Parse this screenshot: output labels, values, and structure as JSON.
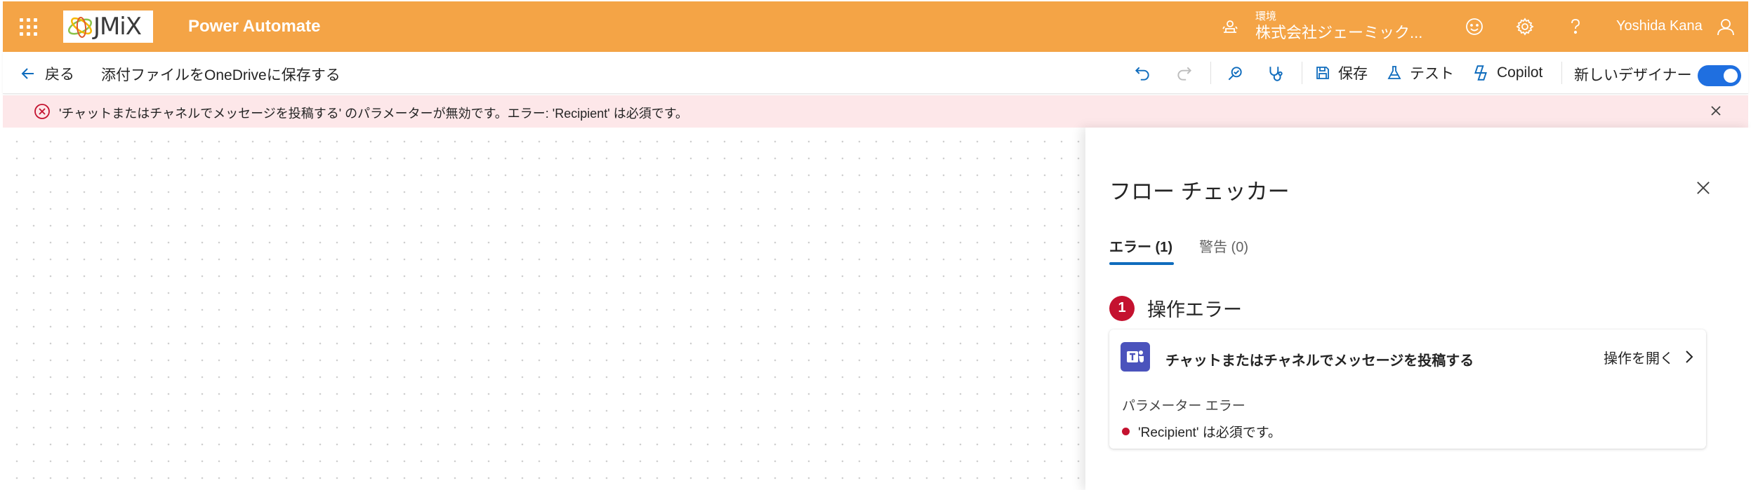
{
  "appbar": {
    "app_name": "Power Automate",
    "logo_text": "JMiX",
    "environment_label": "環境",
    "environment_name": "株式会社ジェーミック...",
    "user_name": "Yoshida Kana",
    "icons": [
      "waffle-icon",
      "environment-icon",
      "feedback-icon",
      "settings-icon",
      "help-icon",
      "user-icon"
    ]
  },
  "cmdbar": {
    "back_label": "戻る",
    "flow_title": "添付ファイルをOneDriveに保存する",
    "save_label": "保存",
    "test_label": "テスト",
    "copilot_label": "Copilot",
    "new_designer_label": "新しいデザイナー",
    "new_designer_on": true
  },
  "banner": {
    "message": "'チャットまたはチャネルでメッセージを投稿する' のパラメーターが無効です。エラー: 'Recipient' は必須です。"
  },
  "panel": {
    "title": "フロー チェッカー",
    "tabs": [
      {
        "label": "エラー (1)",
        "active": true
      },
      {
        "label": "警告 (0)",
        "active": false
      }
    ],
    "section_count": "1",
    "section_title": "操作エラー",
    "card": {
      "action_name": "チャットまたはチャネルでメッセージを投稿する",
      "open_label": "操作を開く",
      "error_type": "パラメーター エラー",
      "error_detail": "'Recipient' は必須です。"
    }
  },
  "colors": {
    "appbar": "#f4a446",
    "banner_bg": "#fde7e9",
    "error_red": "#c4122f",
    "accent_blue": "#0f6cbd",
    "toggle_on": "#1f6fe0",
    "teams_purple": "#4b53bc"
  }
}
